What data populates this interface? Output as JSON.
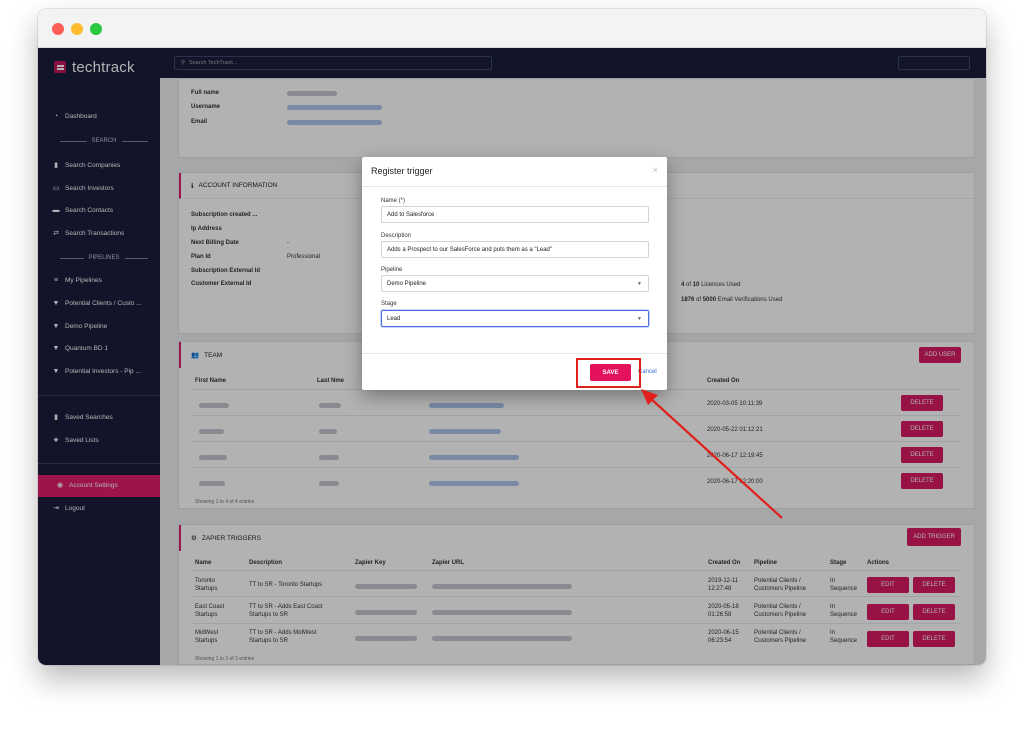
{
  "window": {
    "controls": [
      "close",
      "minimize",
      "maximize"
    ]
  },
  "brand": {
    "name": "techtrack",
    "icon": "techtrack-logo-icon"
  },
  "search": {
    "placeholder": "Search TechTrack..."
  },
  "sidebar": {
    "dashboard": "Dashboard",
    "section_search": "SEARCH",
    "search_items": [
      "Search Companies",
      "Search Investors",
      "Search Contacts",
      "Search Transactions"
    ],
    "section_pipelines": "PIPELINES",
    "pipeline_items": [
      "My Pipelines",
      "Potential Clients / Custo ...",
      "Demo Pipeline",
      "Quantum BD 1",
      "Potential Investors - Pip ..."
    ],
    "saved_searches": "Saved Searches",
    "saved_lists": "Saved Lists",
    "account_settings": "Account Settings",
    "logout": "Logout",
    "accent": "#e01d6b"
  },
  "profile": {
    "full_name_label": "Full name",
    "username_label": "Username",
    "email_label": "Email"
  },
  "account": {
    "title": "ACCOUNT INFORMATION",
    "subscription_created": "Subscription created ...",
    "ip_address": "Ip Address",
    "next_billing": "Next Billing Date",
    "next_billing_value": "-",
    "plan_id": "Plan Id",
    "plan_id_value": "Professional",
    "sub_external": "Subscription External Id",
    "customer_external": "Customer External Id",
    "licences_used": "4",
    "licences_of": "of",
    "licences_total": "10",
    "licences_label": "Licences Used",
    "verifications_used": "1876",
    "verifications_total": "5000",
    "verifications_label": "Email Verifications Used"
  },
  "team": {
    "title": "TEAM",
    "add_user": "ADD USER",
    "col_first": "First Name",
    "col_last": "Last Nme",
    "col_created": "Created On",
    "created": [
      "2020-03-05 10:11:39",
      "2020-05-22 01:12:21",
      "2020-06-17 12:19:45",
      "2020-06-17 12:20:00"
    ],
    "delete": "DELETE",
    "footer": "Showing 1 to 4 of 4 entries"
  },
  "zapier": {
    "title": "ZAPIER TRIGGERS",
    "add_trigger": "ADD TRIGGER",
    "cols": [
      "Name",
      "Description",
      "Zapier Key",
      "Zapier URL",
      "Created On",
      "Pipeline",
      "Stage",
      "Actions"
    ],
    "rows": [
      {
        "name1": "Toronto",
        "name2": "Startups",
        "desc1": "TT to SR - Toronto Startups",
        "desc2": "",
        "created1": "2019-12-11",
        "created2": "12:27:48",
        "pipe1": "Potential Clients /",
        "pipe2": "Customers Pipeline",
        "stage1": "In",
        "stage2": "Sequence"
      },
      {
        "name1": "East Coast",
        "name2": "Startups",
        "desc1": "TT to SR - Adds East Coast",
        "desc2": "Startups to SR",
        "created1": "2020-05-18",
        "created2": "01:26:58",
        "pipe1": "Potential Clients /",
        "pipe2": "Customers Pipeline",
        "stage1": "In",
        "stage2": "Sequence"
      },
      {
        "name1": "MidWest",
        "name2": "Startups",
        "desc1": "TT to SR - Adds MidWest",
        "desc2": "Startups to SR",
        "created1": "2020-06-15",
        "created2": "06:23:54",
        "pipe1": "Potential Clients /",
        "pipe2": "Customers Pipeline",
        "stage1": "In",
        "stage2": "Sequence"
      }
    ],
    "edit": "EDIT",
    "delete": "DELETE",
    "footer": "Showing 1 to 3 of 3 entries"
  },
  "modal": {
    "title": "Register trigger",
    "close": "×",
    "name_label": "Name (*)",
    "name_value": "Add to Salesforce",
    "desc_label": "Description",
    "desc_value": "Adds a Prospect to our SalesForce and puts them as a \"Lead\"",
    "pipeline_label": "Pipeline",
    "pipeline_value": "Demo Pipeline",
    "stage_label": "Stage",
    "stage_value": "Lead",
    "save": "SAVE",
    "cancel": "Cancel"
  },
  "annotation": {
    "color": "#e0201c"
  }
}
